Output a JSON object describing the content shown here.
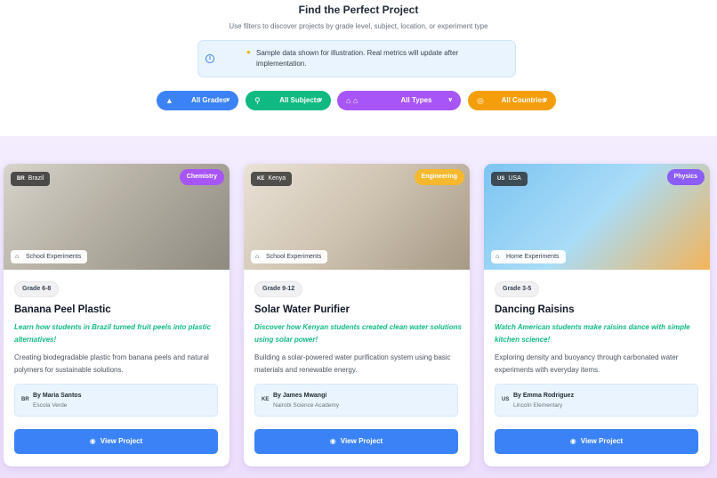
{
  "header": {
    "title": "Find the Perfect Project",
    "subtitle": "Use filters to discover projects by grade level, subject, location, or experiment type",
    "notice": "Sample data shown for illustration. Real metrics will update after implementation."
  },
  "filters": [
    {
      "label": "All Grades",
      "icon": "graduation-cap-icon"
    },
    {
      "label": "All Subjects",
      "icon": "search-icon"
    },
    {
      "label": "All Types",
      "icon": "home-school-icon"
    },
    {
      "label": "All Countries",
      "icon": "globe-icon"
    }
  ],
  "cards": [
    {
      "country_code": "BR",
      "country": "Brazil",
      "subject": "Chemistry",
      "type": "School Experiments",
      "grade": "Grade 6-8",
      "title": "Banana Peel Plastic",
      "tagline": "Learn how students in Brazil turned fruit peels into plastic alternatives!",
      "description": "Creating biodegradable plastic from banana peels and natural polymers for sustainable solutions.",
      "author": "By Maria Santos",
      "school": "Escola Verde",
      "button": "View Project"
    },
    {
      "country_code": "KE",
      "country": "Kenya",
      "subject": "Engineering",
      "type": "School Experiments",
      "grade": "Grade 9-12",
      "title": "Solar Water Purifier",
      "tagline": "Discover how Kenyan students created clean water solutions using solar power!",
      "description": "Building a solar-powered water purification system using basic materials and renewable energy.",
      "author": "By James Mwangi",
      "school": "Nairobi Science Academy",
      "button": "View Project"
    },
    {
      "country_code": "US",
      "country": "USA",
      "subject": "Physics",
      "type": "Home Experiments",
      "grade": "Grade 3-5",
      "title": "Dancing Raisins",
      "tagline": "Watch American students make raisins dance with simple kitchen science!",
      "description": "Exploring density and buoyancy through carbonated water experiments with everyday items.",
      "author": "By Emma Rodriguez",
      "school": "Lincoln Elementary",
      "button": "View Project"
    }
  ],
  "colors": {
    "primary": "#3b82f6",
    "accent_green": "#10b981",
    "accent_purple": "#a855f7",
    "accent_amber": "#f59e0b"
  }
}
